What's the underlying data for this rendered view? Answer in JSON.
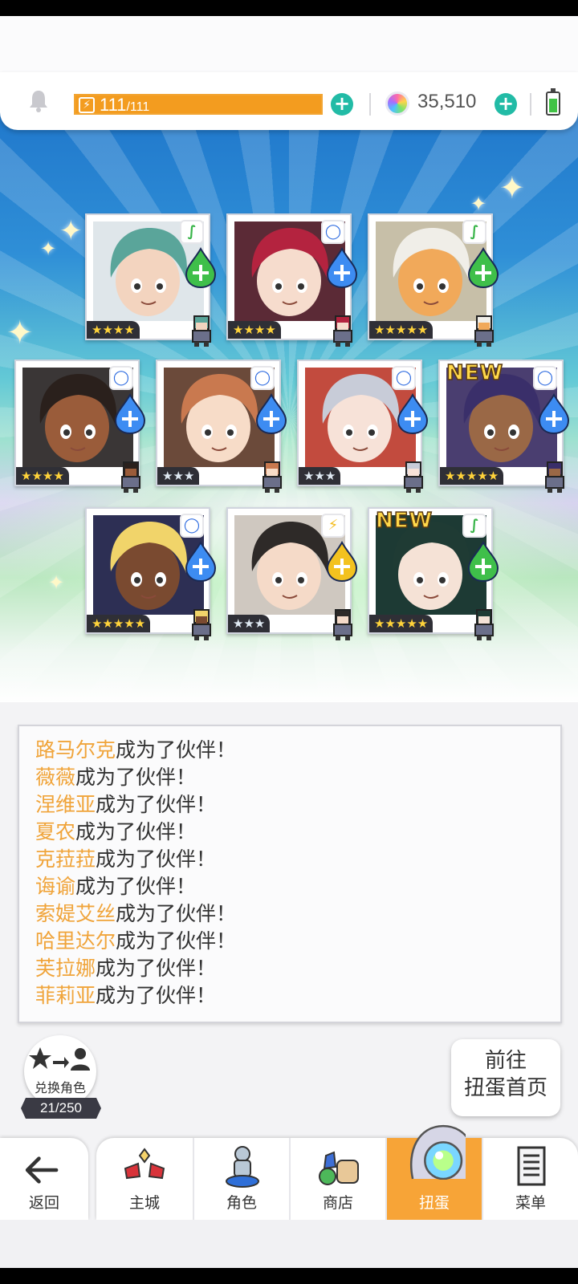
{
  "header": {
    "stamina_current": "111",
    "stamina_separator": "/",
    "stamina_max": "111",
    "gems": "35,510",
    "stamina_icon": "lightning-icon",
    "notification_icon": "bell-icon",
    "battery_level": 0.7
  },
  "cards": [
    {
      "name": "路马尔克",
      "stars": "★★★★",
      "element": "wood",
      "element_glyph": "∫",
      "star_color": "gold"
    },
    {
      "name": "薇薇",
      "stars": "★★★★",
      "element": "water",
      "element_glyph": "◯",
      "star_color": "gold"
    },
    {
      "name": "涅维亚",
      "stars": "★★★★★",
      "element": "wood",
      "element_glyph": "∫",
      "star_color": "gold"
    },
    {
      "name": "夏农",
      "stars": "★★★★",
      "element": "water",
      "element_glyph": "◯",
      "star_color": "gold"
    },
    {
      "name": "克菈菈",
      "stars": "★★★",
      "element": "water",
      "element_glyph": "◯",
      "star_color": "silver"
    },
    {
      "name": "诲谕",
      "stars": "★★★",
      "element": "water",
      "element_glyph": "◯",
      "star_color": "silver"
    },
    {
      "name": "索媞艾丝",
      "stars": "★★★★★",
      "element": "water",
      "element_glyph": "◯",
      "star_color": "gold",
      "tag": "NEW"
    },
    {
      "name": "哈里达尔",
      "stars": "★★★★★",
      "element": "water",
      "element_glyph": "◯",
      "star_color": "gold"
    },
    {
      "name": "芙拉娜",
      "stars": "★★★",
      "element": "thunder",
      "element_glyph": "⚡",
      "star_color": "silver"
    },
    {
      "name": "菲莉亚",
      "stars": "★★★★★",
      "element": "wood",
      "element_glyph": "∫",
      "star_color": "gold",
      "tag": "NEW"
    }
  ],
  "log": {
    "suffix": "成为了伙伴！",
    "entries": [
      "路马尔克",
      "薇薇",
      "涅维亚",
      "夏农",
      "克菈菈",
      "诲谕",
      "索媞艾丝",
      "哈里达尔",
      "芙拉娜",
      "菲莉亚"
    ]
  },
  "exchange": {
    "label": "兑换角色",
    "count": "21/250"
  },
  "go_button": {
    "line1": "前往",
    "line2": "扭蛋首页"
  },
  "nav": {
    "back": "返回",
    "items": [
      {
        "label": "主城",
        "icon": "castle-icon"
      },
      {
        "label": "角色",
        "icon": "character-icon"
      },
      {
        "label": "商店",
        "icon": "shop-icon"
      },
      {
        "label": "扭蛋",
        "icon": "gacha-icon",
        "active": true
      },
      {
        "label": "菜单",
        "icon": "menu-icon"
      }
    ]
  },
  "colors": {
    "accent_orange": "#f7a437",
    "stamina_orange": "#f39c1f",
    "plus_teal": "#22bba6",
    "name_orange": "#f0a43a"
  }
}
